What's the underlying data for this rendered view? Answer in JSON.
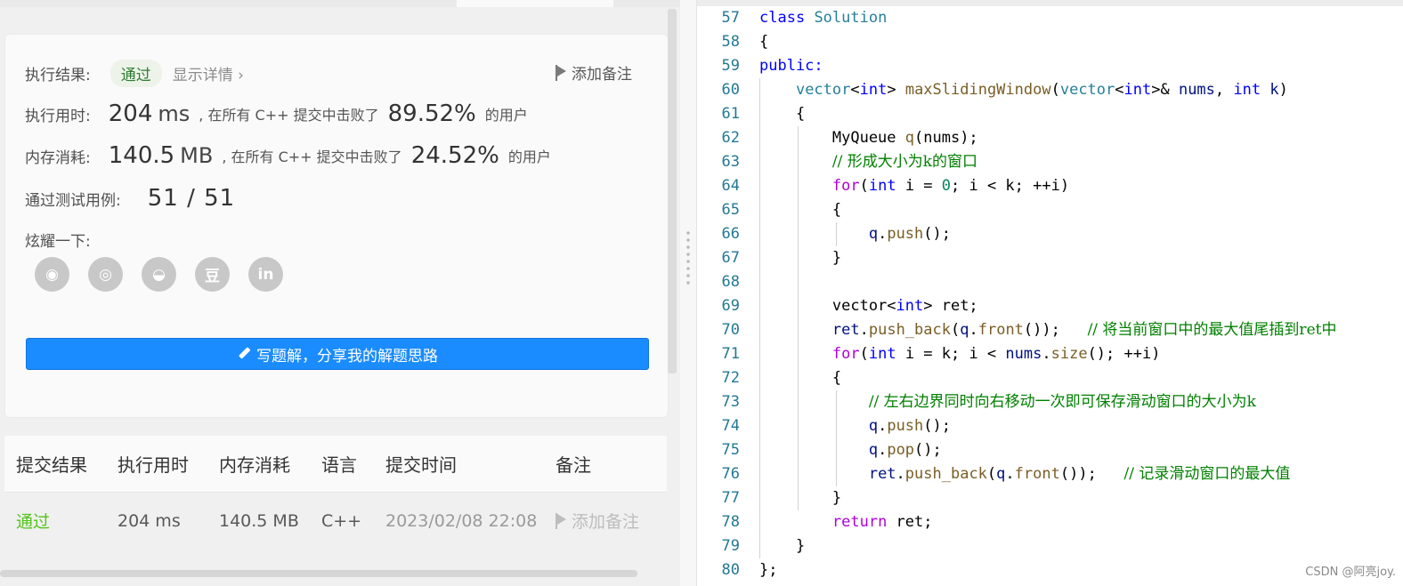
{
  "result_card": {
    "result_label": "执行结果:",
    "result_value": "通过",
    "detail_link": "显示详情 ›",
    "add_note": "添加备注",
    "runtime_label": "执行用时:",
    "runtime_value": "204",
    "runtime_unit": "ms",
    "beat_text": ", 在所有 C++ 提交中击败了",
    "runtime_pct": "89.52%",
    "users_text": "的用户",
    "memory_label": "内存消耗:",
    "memory_value": "140.5",
    "memory_unit": "MB",
    "memory_pct": "24.52%",
    "tests_label": "通过测试用例:",
    "tests_value": "51 / 51",
    "share_label": "炫耀一下:",
    "share_icons": [
      "wechat-icon",
      "weibo-icon",
      "qq-icon",
      "douban-icon",
      "linkedin-icon"
    ],
    "share_glyphs": [
      "◉",
      "◎",
      "◒",
      "豆",
      "in"
    ],
    "write_solution_button": "写题解，分享我的解题思路"
  },
  "submissions": {
    "headers": [
      "提交结果",
      "执行用时",
      "内存消耗",
      "语言",
      "提交时间",
      "备注"
    ],
    "row": {
      "status": "通过",
      "runtime": "204 ms",
      "memory": "140.5 MB",
      "language": "C++",
      "time": "2023/02/08 22:08",
      "note": "添加备注"
    }
  },
  "code": {
    "line_numbers": [
      "57",
      "58",
      "59",
      "60",
      "61",
      "62",
      "63",
      "64",
      "65",
      "66",
      "67",
      "68",
      "69",
      "70",
      "71",
      "72",
      "73",
      "74",
      "75",
      "76",
      "77",
      "78",
      "79",
      "80"
    ]
  },
  "watermark": "CSDN @阿亮joy.",
  "colors": {
    "primary_button": "#1a8cff",
    "pass_green": "#52c41a",
    "line_number": "#237893",
    "comment": "#008000"
  }
}
